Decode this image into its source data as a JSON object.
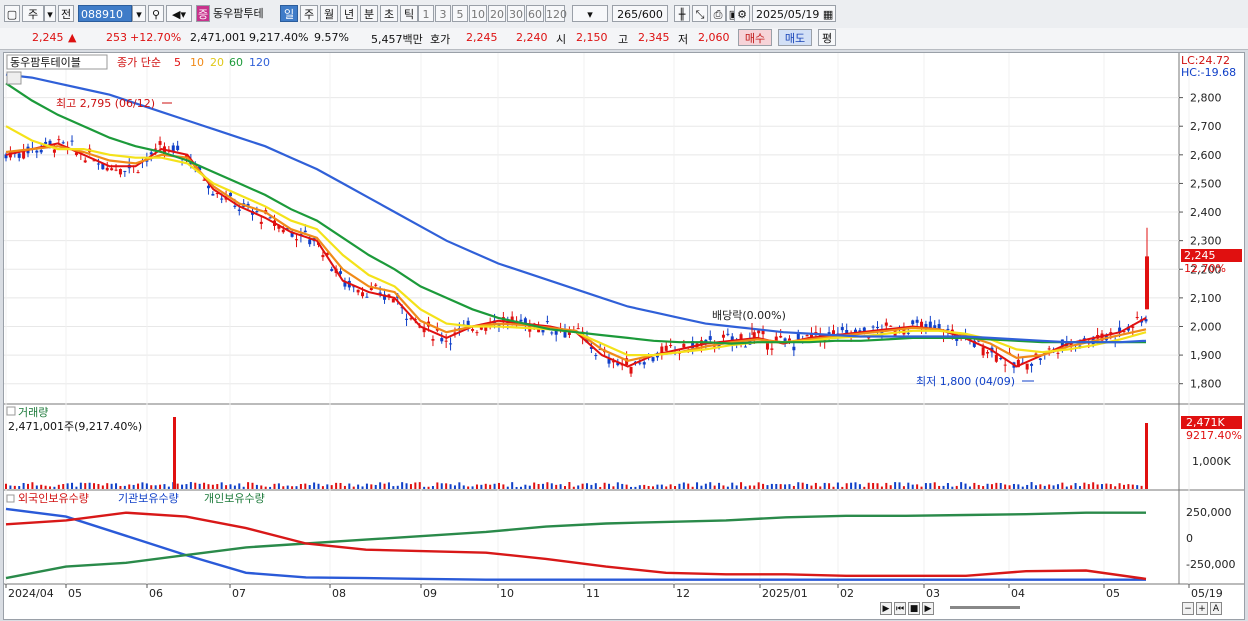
{
  "toolbar": {
    "market": "주",
    "prev": "전",
    "code": "088910",
    "stock_name": "동우팜투테",
    "badge": "증",
    "periods": [
      "일",
      "주",
      "월",
      "년",
      "분",
      "초",
      "틱"
    ],
    "active_period": "일",
    "intervals": [
      "1",
      "3",
      "5",
      "10",
      "20",
      "30",
      "60",
      "120"
    ],
    "range_count": "265",
    "range_total": "/600",
    "date": "2025/05/19"
  },
  "quote": {
    "price": "2,245",
    "change": "253",
    "change_pct": "+12.70%",
    "volume": "2,471,001",
    "volume_ratio": "9,217.40%",
    "turnover": "9.57%",
    "amount": "5,457백만",
    "bid_label": "호가",
    "ask": "2,245",
    "bid": "2,240",
    "open_label": "시",
    "open": "2,150",
    "high_label": "고",
    "high": "2,345",
    "low_label": "저",
    "low": "2,060",
    "buy": "매수",
    "sell": "매도",
    "eval": "평"
  },
  "price_panel": {
    "name_tag": "동우팜투테이블",
    "ma_title": "종가 단순",
    "ma_periods": [
      "5",
      "10",
      "20",
      "60",
      "120"
    ],
    "lc": "LC:24.72",
    "hc": "HC:-19.68",
    "high_note": "최고 2,795 (06/12)",
    "low_note": "최저 1,800 (04/09)",
    "dividend_note": "배당락(0.00%)",
    "last_price": "2,245",
    "last_pct": "12.70%",
    "y_ticks": [
      "2,800",
      "2,700",
      "2,600",
      "2,500",
      "2,400",
      "2,300",
      "2,200",
      "2,100",
      "2,000",
      "1,900",
      "1,800"
    ]
  },
  "volume_panel": {
    "title": "거래량",
    "value": "2,471,001주(9,217.40%)",
    "tag_val": "2,471K",
    "tag_pct": "9217.40%",
    "y_tick": "1,000K"
  },
  "holdings_panel": {
    "foreign": "외국인보유수량",
    "institution": "기관보유수량",
    "individual": "개인보유수량",
    "y_ticks": [
      "250,000",
      "0",
      "-250,000"
    ]
  },
  "x_axis": [
    "2024/04",
    "05",
    "06",
    "07",
    "08",
    "09",
    "10",
    "11",
    "12",
    "2025/01",
    "02",
    "03",
    "04",
    "05",
    "05/19"
  ],
  "colors": {
    "ma5": "#e01010",
    "ma10": "#f08a18",
    "ma20": "#f4e21a",
    "ma60": "#1c9a3a",
    "ma120": "#3060d8",
    "up": "#e01010",
    "down": "#1040c8"
  },
  "chart_data": {
    "type": "line",
    "title": "",
    "series": [
      {
        "name": "5",
        "values": [
          2600,
          2620,
          2640,
          2600,
          2560,
          2560,
          2620,
          2600,
          2480,
          2420,
          2380,
          2330,
          2300,
          2160,
          2120,
          2100,
          2000,
          1960,
          2000,
          2020,
          2010,
          2000,
          1980,
          1900,
          1860,
          1900,
          1920,
          1940,
          1950,
          1960,
          1940,
          1960,
          1970,
          1980,
          1990,
          2000,
          1990,
          1960,
          1920,
          1860,
          1900,
          1940,
          1960,
          1980,
          2030
        ]
      },
      {
        "name": "10",
        "values": [
          2610,
          2620,
          2630,
          2610,
          2580,
          2570,
          2600,
          2590,
          2490,
          2430,
          2400,
          2340,
          2310,
          2200,
          2140,
          2120,
          2020,
          1980,
          2000,
          2010,
          2005,
          1995,
          1985,
          1920,
          1880,
          1900,
          1910,
          1930,
          1945,
          1955,
          1945,
          1955,
          1965,
          1975,
          1985,
          1995,
          1990,
          1970,
          1940,
          1890,
          1900,
          1930,
          1950,
          1970,
          1990
        ]
      },
      {
        "name": "20",
        "values": [
          2700,
          2650,
          2620,
          2620,
          2600,
          2590,
          2590,
          2570,
          2500,
          2460,
          2420,
          2370,
          2340,
          2250,
          2180,
          2140,
          2060,
          2010,
          2000,
          2000,
          1995,
          1990,
          1980,
          1940,
          1900,
          1900,
          1910,
          1920,
          1935,
          1945,
          1945,
          1950,
          1960,
          1965,
          1975,
          1985,
          1985,
          1975,
          1955,
          1920,
          1910,
          1920,
          1935,
          1955,
          1980
        ]
      },
      {
        "name": "60",
        "values": [
          2850,
          2790,
          2740,
          2700,
          2660,
          2630,
          2610,
          2580,
          2540,
          2500,
          2460,
          2410,
          2370,
          2310,
          2250,
          2200,
          2140,
          2100,
          2060,
          2030,
          2010,
          1990,
          1980,
          1970,
          1960,
          1950,
          1945,
          1945,
          1940,
          1945,
          1945,
          1945,
          1950,
          1950,
          1955,
          1960,
          1960,
          1960,
          1955,
          1950,
          1945,
          1945,
          1945,
          1945,
          1945
        ]
      },
      {
        "name": "120",
        "values": [
          2880,
          2870,
          2850,
          2830,
          2810,
          2780,
          2750,
          2720,
          2690,
          2660,
          2630,
          2590,
          2550,
          2500,
          2450,
          2400,
          2350,
          2300,
          2260,
          2220,
          2190,
          2160,
          2130,
          2100,
          2070,
          2050,
          2030,
          2010,
          2000,
          1990,
          1980,
          1975,
          1970,
          1965,
          1965,
          1965,
          1965,
          1965,
          1960,
          1955,
          1950,
          1945,
          1945,
          1945,
          1950
        ]
      }
    ],
    "ylim": [
      1750,
      2900
    ]
  }
}
